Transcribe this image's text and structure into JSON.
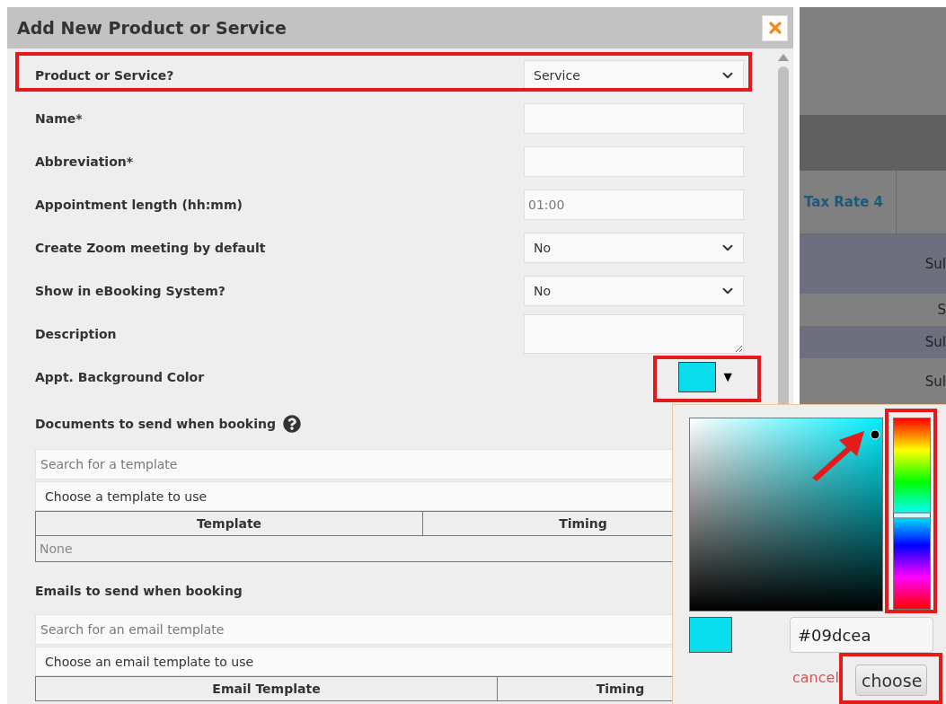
{
  "dialog": {
    "title": "Add New Product or Service",
    "fields": [
      {
        "kind": "select",
        "label": "Product or Service?",
        "value": "Service"
      },
      {
        "kind": "text",
        "label": "Name*"
      },
      {
        "kind": "text",
        "label": "Abbreviation*"
      },
      {
        "kind": "text",
        "label": "Appointment length (hh:mm)",
        "placeholder": "01:00"
      },
      {
        "kind": "select",
        "label": "Create Zoom meeting by default",
        "value": "No"
      },
      {
        "kind": "select",
        "label": "Show in eBooking System?",
        "value": "No"
      },
      {
        "kind": "textarea",
        "label": "Description"
      },
      {
        "kind": "color",
        "label": "Appt. Background Color",
        "caret": "▼"
      }
    ],
    "sections": [
      {
        "title": "Documents to send when booking",
        "help": true,
        "search_placeholder": "Search for a template",
        "choose": "Choose a template to use",
        "columns": [
          "Template",
          "Timing"
        ],
        "empty": "None"
      },
      {
        "title": "Emails to send when booking",
        "help": false,
        "search_placeholder": "Search for an email template",
        "choose": "Choose an email template to use",
        "columns": [
          "Email Template",
          "Timing"
        ]
      }
    ]
  },
  "background_table": {
    "header": "Tax Rate 4",
    "cells": [
      "Sul",
      "S",
      "Sul",
      "Sul"
    ]
  },
  "color_picker": {
    "hex": "#09dcea",
    "hue_slider": {
      "level": 0.51
    },
    "cancel": "cancel",
    "choose": "choose"
  }
}
